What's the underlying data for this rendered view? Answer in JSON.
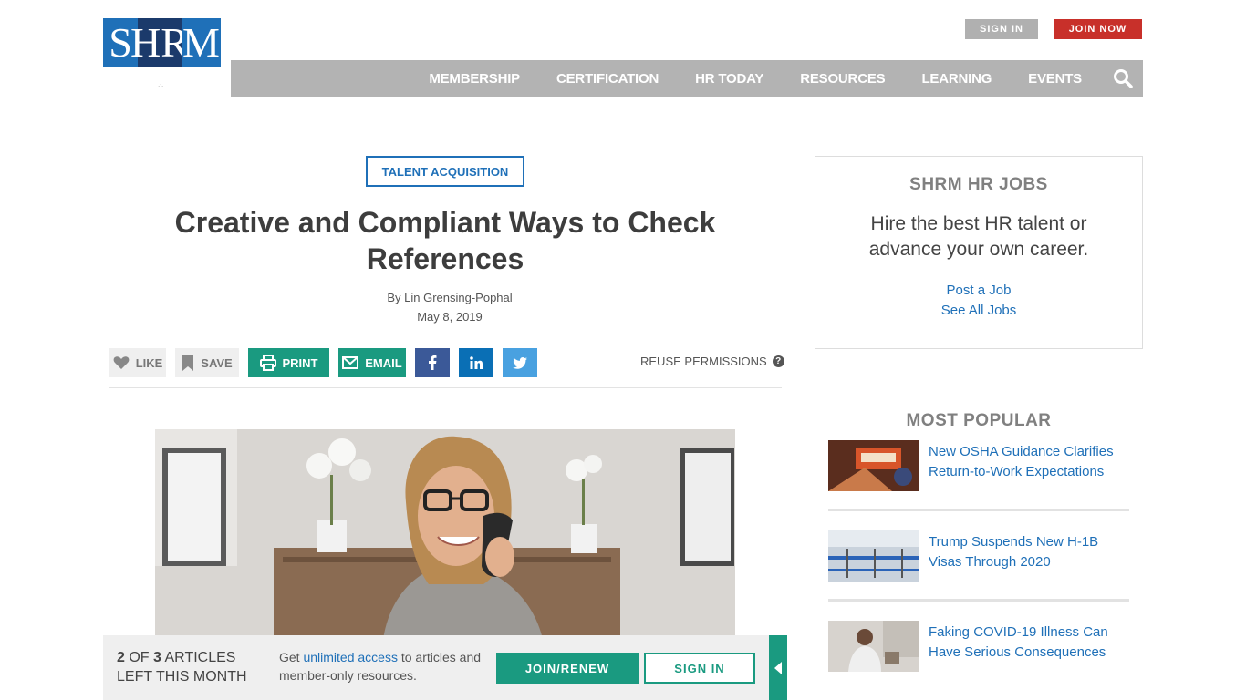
{
  "logo": {
    "letters": [
      "S",
      "H",
      "R",
      "M"
    ],
    "alt": "SHRM"
  },
  "header": {
    "sign_in": "SIGN IN",
    "join_now": "JOIN NOW"
  },
  "nav": {
    "items": [
      "MEMBERSHIP",
      "CERTIFICATION",
      "HR TODAY",
      "RESOURCES",
      "LEARNING",
      "EVENTS"
    ],
    "search_icon": "search-icon"
  },
  "article": {
    "category": "TALENT ACQUISITION",
    "title": "Creative and Compliant Ways to Check References",
    "byline": "By Lin Grensing-Pophal",
    "date": "May 8, 2019",
    "actions": {
      "like": "LIKE",
      "save": "SAVE",
      "print": "PRINT",
      "email": "EMAIL"
    },
    "reuse_permissions": "REUSE PERMISSIONS",
    "image_alt": "Smiling woman with glasses on a phone call"
  },
  "jobs": {
    "heading": "SHRM HR JOBS",
    "subtitle": "Hire the best HR talent or advance your own career.",
    "link_post": "Post a Job",
    "link_all": "See All Jobs"
  },
  "most_popular": {
    "heading": "MOST POPULAR",
    "items": [
      {
        "title": "New OSHA Guidance Clarifies Return-to-Work Expectations"
      },
      {
        "title": "Trump Suspends New H-1B Visas Through 2020"
      },
      {
        "title": "Faking COVID-19 Illness Can Have Serious Consequences"
      }
    ]
  },
  "meter": {
    "count_read": "2",
    "count_of": "OF",
    "count_total": "3",
    "count_suffix": "ARTICLES",
    "count_line2": "LEFT THIS MONTH",
    "msg_prefix": "Get ",
    "msg_link": "unlimited access",
    "msg_suffix": " to articles and member-only resources.",
    "join_renew": "JOIN/RENEW",
    "sign_in": "SIGN IN"
  },
  "colors": {
    "brand_blue": "#1f70b8",
    "brand_navy": "#1b3a6b",
    "join_red": "#c8302a",
    "teal": "#1a9a80",
    "facebook": "#3b5998",
    "linkedin": "#0a6fb5",
    "twitter": "#49a1e0"
  }
}
